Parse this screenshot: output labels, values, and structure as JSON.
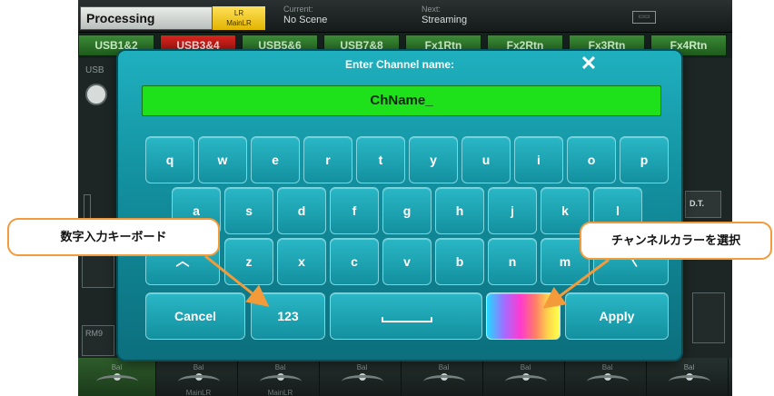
{
  "topbar": {
    "processing_label": "Processing",
    "lr_line1": "LR",
    "lr_line2": "MainLR",
    "current_label": "Current:",
    "current_value": "No Scene",
    "next_label": "Next:",
    "next_value": "Streaming"
  },
  "tabs": [
    "USB1&2",
    "USB3&4",
    "USB5&6",
    "USB7&8",
    "Fx1Rtn",
    "Fx2Rtn",
    "Fx3Rtn",
    "Fx4Rtn"
  ],
  "strip": {
    "usb_label": "USB",
    "rm_label": "RM9",
    "dt_label": "D.T."
  },
  "bottom": {
    "bal_labels": [
      "Bal",
      "Bal",
      "Bal",
      "Bal",
      "Bal",
      "Bal",
      "Bal",
      "Bal"
    ],
    "sub_labels": [
      "",
      "MainLR",
      "MainLR",
      "",
      "",
      "",
      "",
      ""
    ]
  },
  "modal": {
    "title": "Enter Channel name:",
    "name_value": "ChName_",
    "close_glyph": "✕",
    "row1": [
      "q",
      "w",
      "e",
      "r",
      "t",
      "y",
      "u",
      "i",
      "o",
      "p"
    ],
    "row2": [
      "a",
      "s",
      "d",
      "f",
      "g",
      "h",
      "j",
      "k",
      "l"
    ],
    "row3": [
      "z",
      "x",
      "c",
      "v",
      "b",
      "n",
      "m"
    ],
    "shift_glyph": "︿",
    "backspace_glyph": "〈",
    "cancel_label": "Cancel",
    "numeric_label": "123",
    "apply_label": "Apply"
  },
  "annotations": {
    "numeric_keyboard": "数字入力キーボード",
    "channel_color": "チャンネルカラーを選択"
  },
  "colors": {
    "modal_teal": "#1aa3b2",
    "name_field_green": "#1ee01b",
    "callout_orange": "#f39a3a",
    "tab_green": "#2f7a2b",
    "tab_red": "#c41f1a",
    "lr_yellow": "#f3cb1c"
  },
  "icons": [
    "close-icon",
    "shift-icon",
    "backspace-icon",
    "space-icon",
    "color-gradient-icon",
    "knob-icon",
    "battery-icon"
  ]
}
